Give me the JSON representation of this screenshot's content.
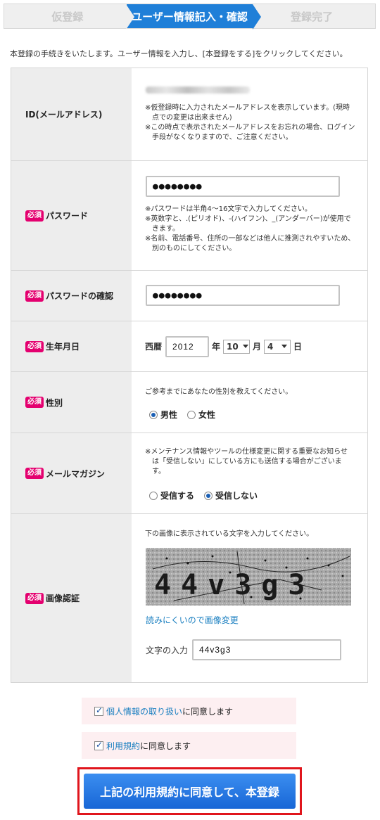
{
  "steps": [
    "仮登録",
    "ユーザー情報記入・確認",
    "登録完了"
  ],
  "intro": "本登録の手続きをいたします。ユーザー情報を入力し、[本登録をする]をクリックしてください。",
  "required_badge": "必須",
  "fields": {
    "id": {
      "label": "ID(メールアドレス)",
      "notes": [
        "※仮登録時に入力されたメールアドレスを表示しています。(現時点での変更は出来ません)",
        "※この時点で表示されたメールアドレスをお忘れの場合、ログイン手段がなくなりますので、ご注意ください。"
      ]
    },
    "password": {
      "label": "パスワード",
      "value": "●●●●●●●●",
      "notes": [
        "※パスワードは半角4〜16文字で入力してください。",
        "※英数字と、.(ピリオド)、-(ハイフン)、_(アンダーバー)が使用できます。",
        "※名前、電話番号、住所の一部などは他人に推測されやすいため、別のものにしてください。"
      ]
    },
    "password_confirm": {
      "label": "パスワードの確認",
      "value": "●●●●●●●●"
    },
    "birthday": {
      "label": "生年月日",
      "era": "西暦",
      "year": "2012",
      "year_unit": "年",
      "month": "10",
      "month_unit": "月",
      "day": "4",
      "day_unit": "日"
    },
    "gender": {
      "label": "性別",
      "note": "ご参考までにあなたの性別を教えてください。",
      "options": [
        "男性",
        "女性"
      ],
      "selected": "男性"
    },
    "mail": {
      "label": "メールマガジン",
      "notes": [
        "※メンテナンス情報やツールの仕様変更に関する重要なお知らせは「受信しない」にしている方にも送信する場合がございます。"
      ],
      "options": [
        "受信する",
        "受信しない"
      ],
      "selected": "受信しない"
    },
    "captcha": {
      "label": "画像認証",
      "instruction": "下の画像に表示されている文字を入力してください。",
      "image_text": "44v3g3",
      "change_link": "読みにくいので画像変更",
      "input_label": "文字の入力",
      "input_value": "44v3g3"
    }
  },
  "agreements": [
    {
      "link": "個人情報の取り扱い",
      "suffix": "に同意します",
      "checked": true
    },
    {
      "link": "利用規約",
      "suffix": "に同意します",
      "checked": true
    }
  ],
  "submit_label": "上記の利用規約に同意して、本登録",
  "colors": {
    "accent": "#1f7fd8",
    "badge": "#e4006f",
    "highlight_border": "#e0151c"
  }
}
